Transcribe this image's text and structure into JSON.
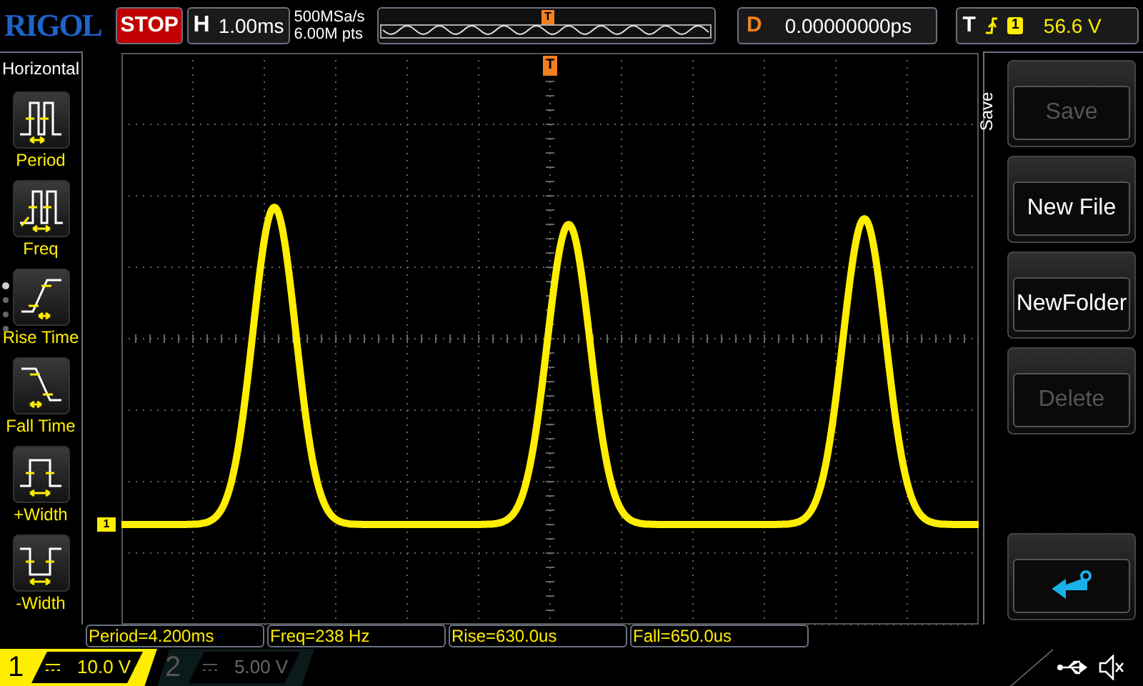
{
  "header": {
    "logo": "RIGOL",
    "run_state": "STOP",
    "timebase_label": "H",
    "timebase": "1.00ms",
    "sample_rate": "500MSa/s",
    "memory_depth": "6.00M pts",
    "overview_trigger_marker": "T",
    "delay_label": "D",
    "delay": "0.00000000ps",
    "trigger_label": "T",
    "trigger_source": "1",
    "trigger_level": "56.6 V"
  },
  "left_menu": {
    "title": "Horizontal",
    "items": [
      {
        "kind": "period",
        "label": "Period"
      },
      {
        "kind": "freq",
        "label": "Freq"
      },
      {
        "kind": "rise",
        "label": "Rise Time"
      },
      {
        "kind": "fall",
        "label": "Fall Time"
      },
      {
        "kind": "pwidth",
        "label": "+Width"
      },
      {
        "kind": "nwidth",
        "label": "-Width"
      }
    ]
  },
  "screen": {
    "trigger_marker": "T",
    "ground_marker": "1"
  },
  "right_menu": {
    "title": "Save",
    "keys": [
      {
        "kind": "text",
        "label": "Save",
        "disabled": true
      },
      {
        "kind": "text",
        "label": "New File",
        "disabled": false
      },
      {
        "kind": "text",
        "label": "NewFolder",
        "disabled": false
      },
      {
        "kind": "text",
        "label": "Delete",
        "disabled": true
      },
      {
        "kind": "return",
        "disabled": false
      }
    ]
  },
  "measurements": [
    "Period=4.200ms",
    "Freq=238 Hz",
    "Rise=630.0us",
    "Fall=650.0us"
  ],
  "channels": [
    {
      "number": "1",
      "scale": "10.0 V",
      "on": true
    },
    {
      "number": "2",
      "scale": "5.00 V",
      "on": false
    }
  ]
}
